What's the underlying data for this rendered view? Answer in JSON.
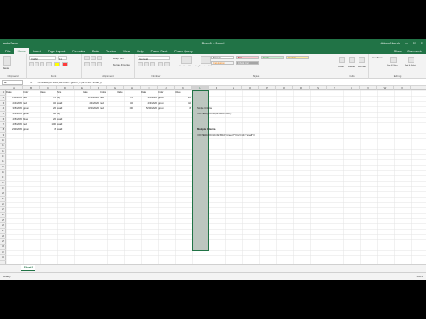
{
  "titlebar": {
    "autosave": "AutoSave",
    "filename": "Book1 - Excel",
    "user": "Adam Norah",
    "controls": [
      "—",
      "☐",
      "✕"
    ]
  },
  "tabs": [
    "File",
    "Home",
    "Insert",
    "Page Layout",
    "Formulas",
    "Data",
    "Review",
    "View",
    "Help",
    "Power Pivot",
    "Power Query"
  ],
  "share": [
    "Share",
    "Comments"
  ],
  "ribbon": {
    "groups": [
      "Clipboard",
      "Font",
      "Alignment",
      "Number",
      "Styles",
      "Cells",
      "Editing"
    ],
    "paste": "Paste",
    "font_name": "Calibri",
    "font_size": "11",
    "wrap_text": "Wrap Text",
    "merge": "Merge & Center",
    "number_format": "General",
    "conditional": "Conditional Formatting",
    "format_table": "Format as Table",
    "styles": [
      {
        "label": "Normal",
        "bg": "#ffffff",
        "fg": "#000000"
      },
      {
        "label": "Bad",
        "bg": "#ffc7ce",
        "fg": "#9c0006"
      },
      {
        "label": "Good",
        "bg": "#c6efce",
        "fg": "#006100"
      },
      {
        "label": "Neutral",
        "bg": "#ffeb9c",
        "fg": "#9c5700"
      },
      {
        "label": "Calculation",
        "bg": "#f2f2f2",
        "fg": "#fa7d00"
      },
      {
        "label": "Check Cell",
        "bg": "#a5a5a5",
        "fg": "#ffffff"
      }
    ],
    "insert": "Insert",
    "delete": "Delete",
    "format": "Format",
    "autosum": "AutoSum",
    "sort_filter": "Sort & Filter",
    "find_select": "Find & Select"
  },
  "formula_bar": {
    "name_box": "A2",
    "fx": "fx",
    "formula": "=FILTER(A2:D10,(B2:B10=\"green\")*(C2:C10<\"small\"))"
  },
  "columns": [
    "A",
    "B",
    "C",
    "D",
    "E",
    "F",
    "G",
    "H",
    "I",
    "J",
    "K",
    "L",
    "M",
    "N",
    "O",
    "P",
    "Q",
    "R",
    "S",
    "T",
    "U",
    "V",
    "W",
    "X"
  ],
  "rows": [
    "1",
    "2",
    "3",
    "4",
    "5",
    "6",
    "7",
    "8",
    "9",
    "10",
    "11",
    "12",
    "13",
    "14",
    "15",
    "16",
    "17",
    "18",
    "19",
    "20",
    "21",
    "22",
    "23",
    "24",
    "25",
    "26",
    "27",
    "28",
    "29",
    "30",
    "31",
    "32"
  ],
  "headers": [
    "Date",
    "Color",
    "Value",
    "Size"
  ],
  "table1": [
    [
      "1/30/2020",
      "red",
      "70",
      "big"
    ],
    [
      "2/4/2020",
      "red",
      "32",
      "small"
    ],
    [
      "3/5/2020",
      "green",
      "26",
      "small"
    ],
    [
      "4/3/2020",
      "green",
      "42",
      "big"
    ],
    [
      "4/5/2020",
      "blue",
      "26",
      "small"
    ],
    [
      "4/5/2020",
      "red",
      "100",
      "small"
    ],
    [
      "5/30/2020",
      "green",
      "8",
      "small"
    ]
  ],
  "table2": [
    [
      "1/30/2020",
      "red",
      "70"
    ],
    [
      "2/4/2020",
      "red",
      "32"
    ],
    [
      "3/30/2020",
      "red",
      "100"
    ]
  ],
  "table3": [
    [
      "3/5/2020",
      "green",
      "26"
    ],
    [
      "4/3/2020",
      "green",
      "42"
    ],
    [
      "5/30/2020",
      "green",
      "8"
    ]
  ],
  "notes": {
    "single_title": "Single Criteria",
    "single_formula": "=FILTER(A2:D10,B2:B10=\"red\")",
    "multi_title": "Multiple Criteria",
    "multi_formula": "=FILTER(A2:D10,(B2:B10=\"green\")*(C2:C10<\"small\"))"
  },
  "sheet_tab": "Sheet1",
  "status": {
    "ready": "Ready",
    "zoom": "100%"
  }
}
